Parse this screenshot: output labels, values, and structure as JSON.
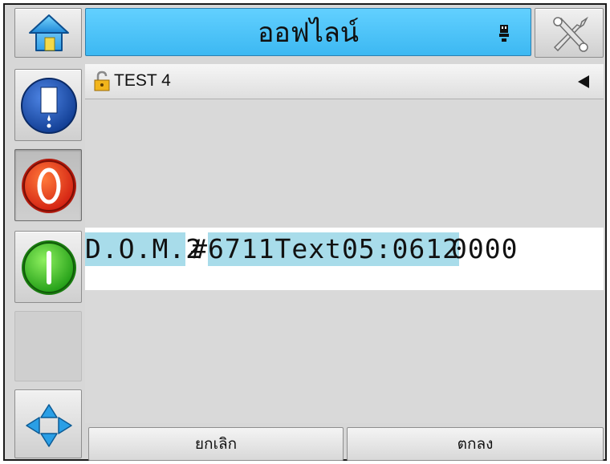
{
  "header": {
    "title": "ออฟไลน์",
    "home_icon": "home-icon",
    "usb_icon": "usb-icon",
    "tools_icon": "tools-icon"
  },
  "sidebar": {
    "items": [
      {
        "name": "ink-icon"
      },
      {
        "name": "stop-icon"
      },
      {
        "name": "start-icon"
      },
      {
        "name": "empty"
      },
      {
        "name": "navigate-icon"
      }
    ]
  },
  "job": {
    "name": "TEST 4",
    "lock_icon": "unlocked-icon",
    "arrow_icon": "left-arrow-icon"
  },
  "print_preview": {
    "segments": [
      {
        "text": "D.O.M. ",
        "highlight": true
      },
      {
        "text": "2",
        "highlight": false
      },
      {
        "text": "#",
        "highlight": false
      },
      {
        "text": "6711",
        "highlight": true
      },
      {
        "text": "Text",
        "highlight": true
      },
      {
        "text": "05:0612",
        "highlight": true
      },
      {
        "text": "0000",
        "highlight": false
      }
    ]
  },
  "footer": {
    "cancel_label": "ยกเลิก",
    "ok_label": "ตกลง"
  },
  "colors": {
    "title_bar": "#4cc4fb",
    "highlight": "#a8dcea",
    "stop_red": "#e8461a",
    "start_green": "#33c41d",
    "ink_blue": "#1b4fb5"
  }
}
